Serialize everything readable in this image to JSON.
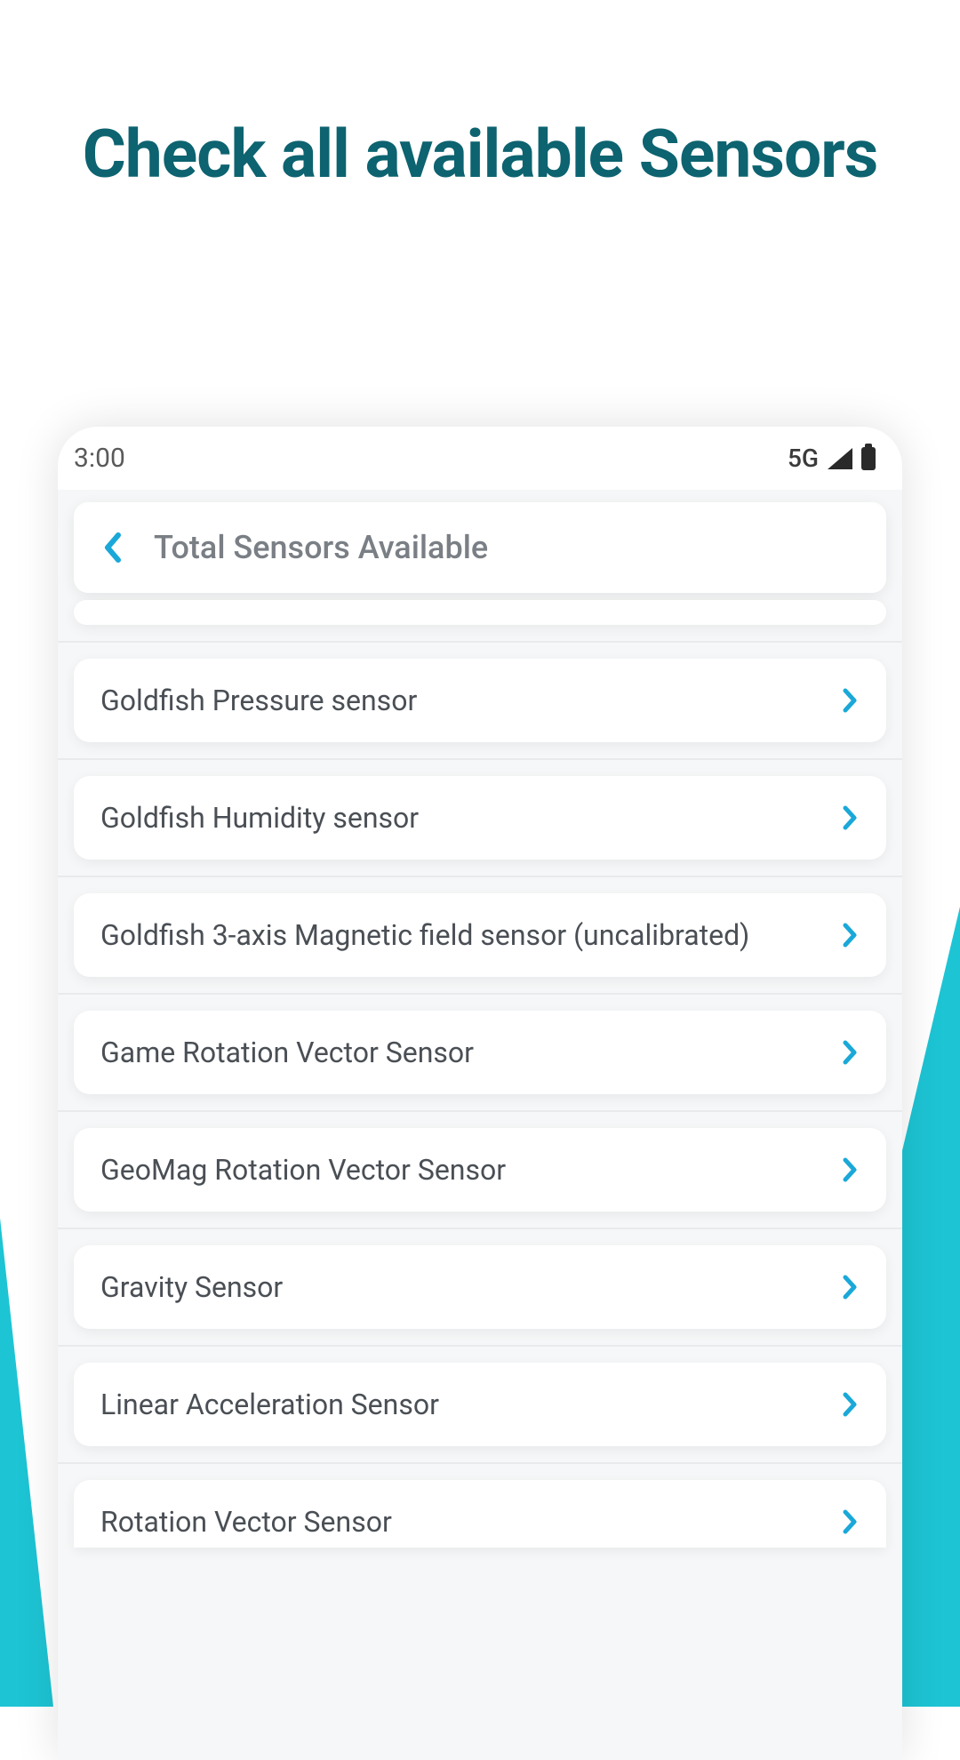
{
  "page": {
    "title": "Check all available Sensors"
  },
  "statusBar": {
    "time": "3:00",
    "network": "5G"
  },
  "appHeader": {
    "title": "Total Sensors Available"
  },
  "sensors": [
    {
      "label": "Goldfish Pressure sensor"
    },
    {
      "label": "Goldfish Humidity sensor"
    },
    {
      "label": "Goldfish 3-axis Magnetic field sensor (uncalibrated)"
    },
    {
      "label": "Game Rotation Vector Sensor"
    },
    {
      "label": "GeoMag Rotation Vector Sensor"
    },
    {
      "label": "Gravity Sensor"
    },
    {
      "label": "Linear Acceleration Sensor"
    },
    {
      "label": "Rotation Vector Sensor"
    }
  ],
  "colors": {
    "accent": "#1aa8d8",
    "accentLight": "#2dc3e8"
  }
}
